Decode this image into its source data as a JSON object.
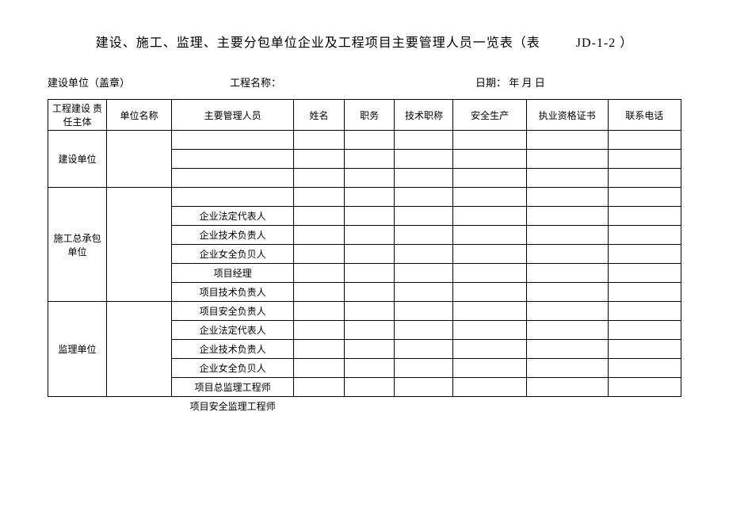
{
  "title": {
    "main": "建设、施工、监理、主要分包单位企业及工程项目主要管理人员一览表（表",
    "code": "JD-1-2 ）"
  },
  "meta": {
    "unit_label": "建设单位（盖章）",
    "project_label": "工程名称：",
    "date_label": "日期：   年  月  日"
  },
  "headers": {
    "col1": "工程建设 责任主体",
    "col2": "单位名称",
    "col3": "主要管理人员",
    "col4": "姓名",
    "col5": "职务",
    "col6": "技术职称",
    "col7": "安全生产",
    "col8": "执业资格证书",
    "col9": "联系电话"
  },
  "sections": {
    "s1_label": "建设单位",
    "s2_label": "施工总承包单位",
    "s3_label": "监理单位"
  },
  "roles": {
    "r1": "企业法定代表人",
    "r2": "企业技术负责人",
    "r3": "企业女全负贝人",
    "r4": "项目经理",
    "r5": "项目技术负责人",
    "r6": "项目安全负责人",
    "r7": "企业法定代表人",
    "r8": "企业技术负责人",
    "r9": "企业女全负贝人",
    "r10": "项目总监理工程师",
    "r11": "项目安全监理工程师"
  }
}
